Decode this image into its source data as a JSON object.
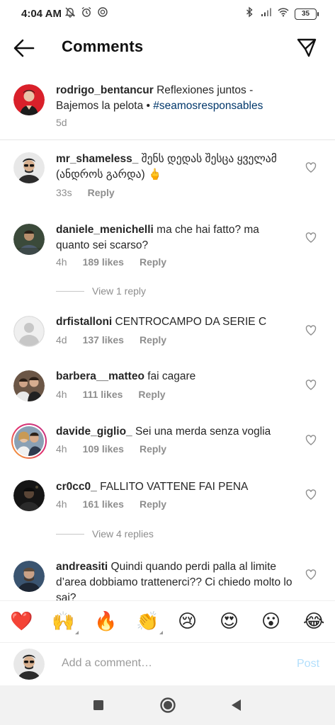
{
  "status_bar": {
    "time": "4:04 AM",
    "battery": "35"
  },
  "header": {
    "title": "Comments"
  },
  "caption": {
    "username": "rodrigo_bentancur",
    "text": "Reflexiones juntos - Bajemos la pelota •",
    "hashtag": "#seamosresponsables",
    "time": "5d"
  },
  "comments": [
    {
      "username": "mr_shameless_",
      "text": "შენს დედას შესცა ყველამ (ანდროს გარდა) 🖕",
      "time": "33s",
      "likes": "",
      "reply": "Reply"
    },
    {
      "username": "daniele_menichelli",
      "text": "ma che hai fatto? ma quanto sei scarso?",
      "time": "4h",
      "likes": "189 likes",
      "reply": "Reply",
      "view_replies": "View 1 reply"
    },
    {
      "username": "drfistalloni",
      "text": "CENTROCAMPO DA SERIE C",
      "time": "4d",
      "likes": "137 likes",
      "reply": "Reply"
    },
    {
      "username": "barbera__matteo",
      "text": "fai cagare",
      "time": "4h",
      "likes": "111 likes",
      "reply": "Reply"
    },
    {
      "username": "davide_giglio_",
      "text": "Sei una merda senza voglia",
      "time": "4h",
      "likes": "109 likes",
      "reply": "Reply"
    },
    {
      "username": "cr0cc0_",
      "text": "FALLITO VATTENE FAI PENA",
      "time": "4h",
      "likes": "161 likes",
      "reply": "Reply",
      "view_replies": "View 4 replies"
    },
    {
      "username": "andreasiti",
      "text": "Quindi quando perdi palla al limite d’area dobbiamo trattenerci?? Ci chiedo molto lo sai?",
      "time": "",
      "likes": "",
      "reply": ""
    }
  ],
  "emoji_bar": {
    "emojis": [
      "❤️",
      "🙌",
      "🔥",
      "👏",
      "😢",
      "😍",
      "😮",
      "😂"
    ]
  },
  "composer": {
    "placeholder": "Add a comment…",
    "post_label": "Post"
  },
  "colors": {
    "hashtag": "#00376b",
    "meta_gray": "#8e8e8e",
    "post_disabled": "#b2dffc",
    "heart_red": "#e0102b"
  }
}
